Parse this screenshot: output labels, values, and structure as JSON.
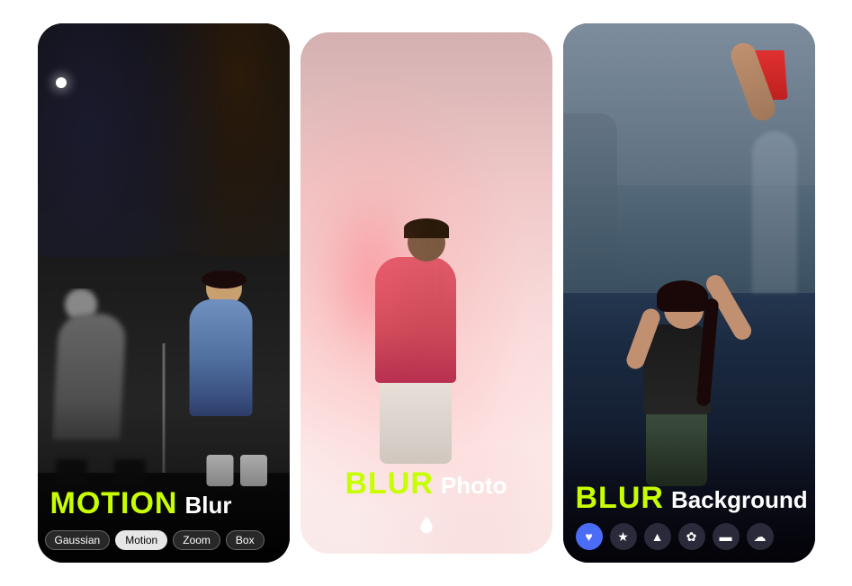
{
  "cards": [
    {
      "id": "left",
      "title_accent": "MOTION",
      "title_plain": "Blur",
      "filter_tabs": [
        {
          "label": "Gaussian",
          "active": false
        },
        {
          "label": "Motion",
          "active": true
        },
        {
          "label": "Zoom",
          "active": false
        },
        {
          "label": "Box",
          "active": false
        }
      ]
    },
    {
      "id": "middle",
      "title_accent": "BLUR",
      "title_plain": "Photo",
      "icon": "droplet"
    },
    {
      "id": "right",
      "title_accent": "BLUR",
      "title_plain": "Background",
      "icons": [
        "heart",
        "star",
        "triangle",
        "game",
        "minus",
        "cloud"
      ]
    }
  ],
  "colors": {
    "accent_green": "#c8ff00",
    "white": "#ffffff",
    "icon_blue": "#4a6cf7",
    "icon_dark": "#2a2a3a"
  },
  "labels": {
    "filter_gaussian": "Gaussian",
    "filter_motion": "Motion",
    "filter_zoom": "Zoom",
    "filter_box": "Box",
    "left_accent": "MOTION",
    "left_plain": "Blur",
    "mid_accent": "BLUR",
    "mid_plain": "Photo",
    "right_accent": "BLUR",
    "right_plain": "Background"
  }
}
